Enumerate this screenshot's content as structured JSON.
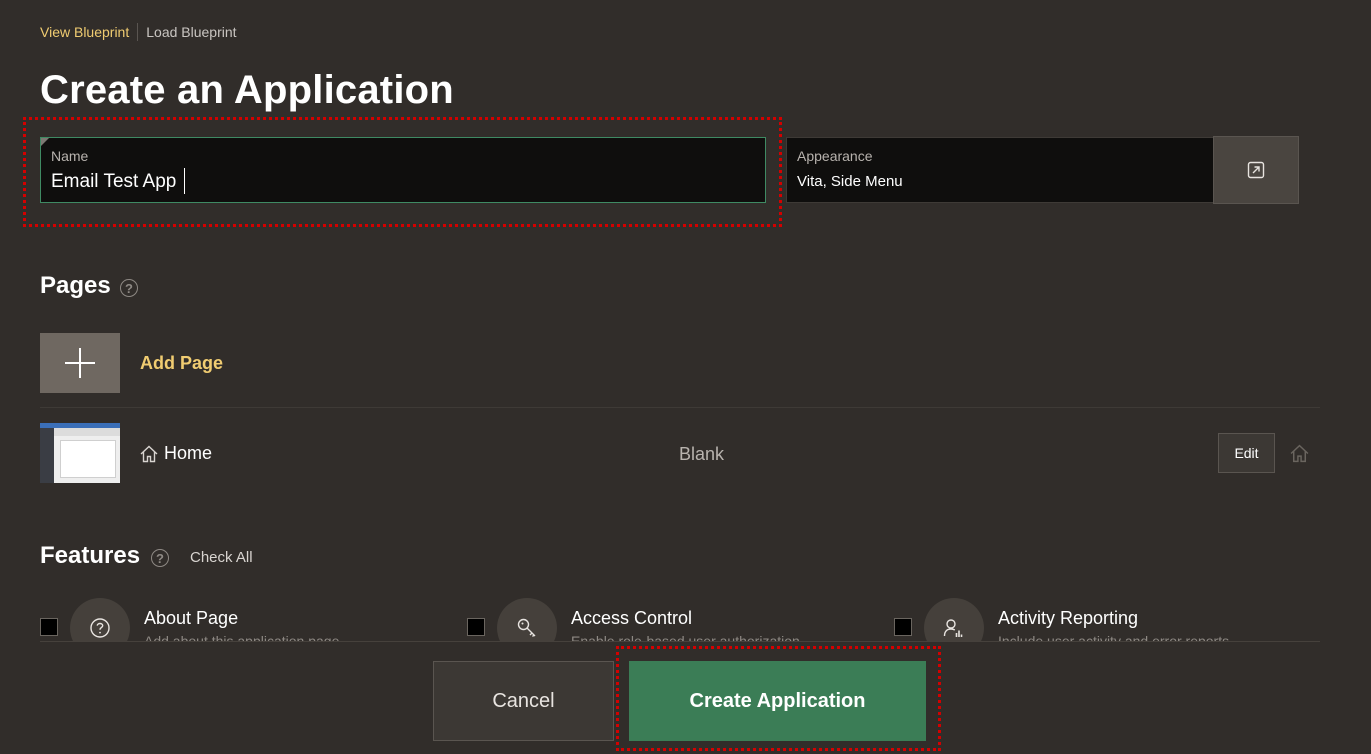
{
  "breadcrumb": {
    "view_blueprint": "View Blueprint",
    "load_blueprint": "Load Blueprint"
  },
  "title": "Create an Application",
  "name_field": {
    "label": "Name",
    "value": "Email Test App"
  },
  "appearance_field": {
    "label": "Appearance",
    "value": "Vita, Side Menu"
  },
  "pages": {
    "heading": "Pages",
    "help_glyph": "?",
    "add_page_label": "Add Page",
    "items": [
      {
        "name": "Home",
        "type": "Blank",
        "edit_label": "Edit"
      }
    ]
  },
  "features": {
    "heading": "Features",
    "help_glyph": "?",
    "check_all_label": "Check All",
    "items": [
      {
        "title": "About Page",
        "description": "Add about this application page",
        "icon": "question-icon",
        "checked": false
      },
      {
        "title": "Access Control",
        "description": "Enable role-based user authorization",
        "icon": "key-icon",
        "checked": false
      },
      {
        "title": "Activity Reporting",
        "description": "Include user activity and error reports",
        "icon": "user-chart-icon",
        "checked": false
      }
    ]
  },
  "actions": {
    "cancel_label": "Cancel",
    "create_label": "Create Application"
  },
  "colors": {
    "background": "#312d2a",
    "accent": "#f0cc71",
    "primary_button": "#3b7d56",
    "field_focus_border": "#3f8a63",
    "highlight": "#d40000"
  }
}
